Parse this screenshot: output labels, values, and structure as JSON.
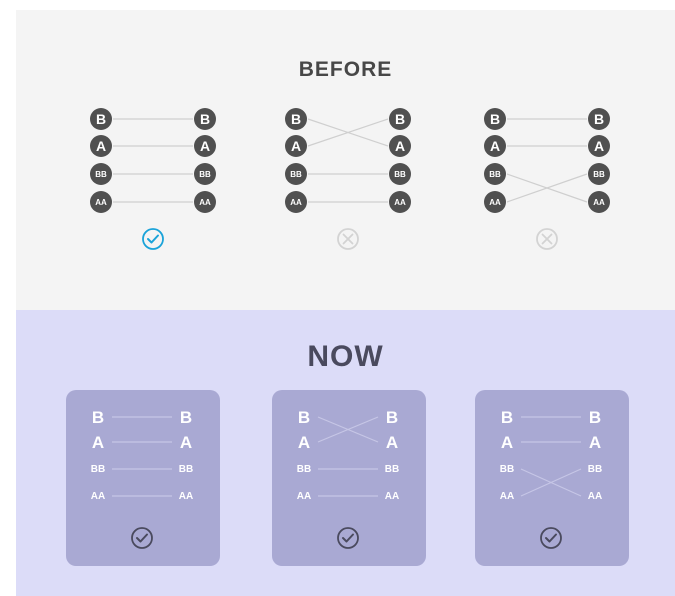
{
  "before": {
    "title": "BEFORE",
    "diagrams": [
      {
        "left": [
          "B",
          "A",
          "BB",
          "AA"
        ],
        "right": [
          "B",
          "A",
          "BB",
          "AA"
        ],
        "links": [
          [
            0,
            0
          ],
          [
            1,
            1
          ],
          [
            2,
            2
          ],
          [
            3,
            3
          ]
        ],
        "status": "check",
        "status_icon": "check-circle-icon",
        "status_color": "#1aa3d9"
      },
      {
        "left": [
          "B",
          "A",
          "BB",
          "AA"
        ],
        "right": [
          "B",
          "A",
          "BB",
          "AA"
        ],
        "links": [
          [
            0,
            1
          ],
          [
            1,
            0
          ],
          [
            2,
            2
          ],
          [
            3,
            3
          ]
        ],
        "status": "cross",
        "status_icon": "cross-circle-icon",
        "status_color": "#d3d3d3"
      },
      {
        "left": [
          "B",
          "A",
          "BB",
          "AA"
        ],
        "right": [
          "B",
          "A",
          "BB",
          "AA"
        ],
        "links": [
          [
            0,
            0
          ],
          [
            1,
            1
          ],
          [
            2,
            3
          ],
          [
            3,
            2
          ]
        ],
        "status": "cross",
        "status_icon": "cross-circle-icon",
        "status_color": "#d3d3d3"
      }
    ]
  },
  "now": {
    "title": "NOW",
    "diagrams": [
      {
        "left": [
          "B",
          "A",
          "BB",
          "AA"
        ],
        "right": [
          "B",
          "A",
          "BB",
          "AA"
        ],
        "links": [
          [
            0,
            0
          ],
          [
            1,
            1
          ],
          [
            2,
            2
          ],
          [
            3,
            3
          ]
        ],
        "status": "check",
        "status_icon": "check-circle-icon"
      },
      {
        "left": [
          "B",
          "A",
          "BB",
          "AA"
        ],
        "right": [
          "B",
          "A",
          "BB",
          "AA"
        ],
        "links": [
          [
            0,
            1
          ],
          [
            1,
            0
          ],
          [
            2,
            2
          ],
          [
            3,
            3
          ]
        ],
        "status": "check",
        "status_icon": "check-circle-icon"
      },
      {
        "left": [
          "B",
          "A",
          "BB",
          "AA"
        ],
        "right": [
          "B",
          "A",
          "BB",
          "AA"
        ],
        "links": [
          [
            0,
            0
          ],
          [
            1,
            1
          ],
          [
            2,
            3
          ],
          [
            3,
            2
          ]
        ],
        "status": "check",
        "status_icon": "check-circle-icon"
      }
    ]
  },
  "colors": {
    "before_background": "#f4f4f4",
    "now_background": "#dcdcf8",
    "card_background": "#a9a9d3",
    "node_fill": "#505050",
    "link_line": "#cfcfcf",
    "now_text": "#ffffff",
    "check_accent": "#1aa3d9"
  }
}
